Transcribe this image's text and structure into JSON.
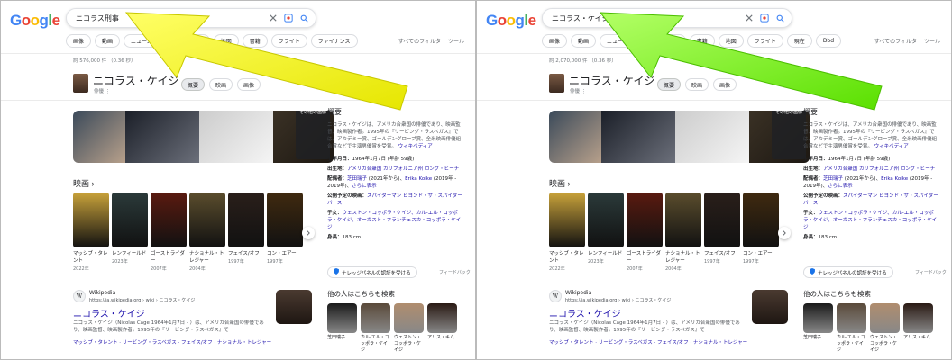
{
  "colors": {
    "arrow_left": "#ffff00",
    "arrow_right": "#7dff00",
    "link": "#1a0dab",
    "logo": [
      "#4285f4",
      "#ea4335",
      "#fbbc05",
      "#4285f4",
      "#34a853",
      "#ea4335"
    ]
  },
  "left": {
    "logo": "Google",
    "query": "ニコラス刑事",
    "chips": [
      "画像",
      "動画",
      "ニュース",
      "ショッピング",
      "地図",
      "書籍",
      "フライト",
      "ファイナンス"
    ],
    "filters": "すべてのフィルタ",
    "tools": "ツール",
    "stats": "約 576,000 件 （0.36 秒）",
    "entity_tabs": [
      "概要",
      "映画",
      "画像"
    ],
    "result_stats_count": "576,000"
  },
  "right": {
    "logo": "Google",
    "query": "ニコラス・ケイジ",
    "chips": [
      "画像",
      "動画",
      "ニュース",
      "ショッピング",
      "書籍",
      "地図",
      "フライト",
      "現在",
      "Dbd"
    ],
    "filters": "すべてのフィルタ",
    "tools": "ツール",
    "stats": "約 2,070,000 件 （0.36 秒）",
    "entity_tabs": [
      "概要",
      "映画",
      "画像"
    ]
  },
  "entity": {
    "name": "ニコラス・ケイジ",
    "subtitle": "俳優"
  },
  "strip": {
    "more_label": "その他の画像"
  },
  "movies_section": {
    "title": "映画"
  },
  "movies": [
    {
      "title": "マッシブ・タレント",
      "year": "2022年"
    },
    {
      "title": "レンフィールド",
      "year": "2023年"
    },
    {
      "title": "ゴーストライダー",
      "year": "2007年"
    },
    {
      "title": "ナショナル・トレジャー",
      "year": "2004年"
    },
    {
      "title": "フェイス/オフ",
      "year": "1997年"
    },
    {
      "title": "コン・エアー",
      "year": "1997年"
    }
  ],
  "knowledge": {
    "title": "概要",
    "desc": "ニコラス・ケイジは、アメリカ合衆国の俳優であり、映画監督、映画製作者。1995年の『リービング・ラスベガス』では、アカデミー賞、ゴールデングローブ賞、全米映画俳優組合賞などで主演男優賞を受賞。",
    "wiki_link": "ウィキペディア",
    "born_label": "生年月日：",
    "born_value": "1964年1月7日 (年齢 59歳)",
    "birthplace_label": "出生地：",
    "birthplace_value": "アメリカ合衆国 カリフォルニア州 ロング・ビーチ",
    "spouse_label": "配偶者：",
    "spouse_1": "芝田瑞子",
    "spouse_1_years": " (2021年から)、",
    "spouse_2": "Erika Koike",
    "spouse_2_years": " (2019年 - 2019年)、",
    "spouse_more": "さらに表示",
    "upcoming_label": "公開予定の映画：",
    "upcoming_value": "スパイダーマン ビヨンド・ザ・スパイダーバース",
    "children_label": "子女：",
    "children_value": "ウェストン・コッポラ・ケイジ、カル-エル・コッポラ・ケイジ、オーガスト・フランチェスカ・コッポラ・ケイジ",
    "height_label": "身長：",
    "height_value": "183 cm"
  },
  "verify_label": "ナレッジパネルの認証を受ける",
  "feedback": "フィードバック",
  "result": {
    "site": "Wikipedia",
    "url": "https://ja.wikipedia.org › wiki › ニコラス・ケイジ",
    "title": "ニコラス・ケイジ",
    "snippet": "ニコラス・ケイジ（Nicolas Cage 1964年1月7日 - ）は、アメリカ合衆国の俳優であり、映画監督、映画製作者。1995年の『リービング・ラスベガス』で",
    "links": "マッシブ・タレント · リービング・ラスベガス · フェイス/オフ · ナショナル・トレジャー"
  },
  "people_also": {
    "title": "他の人はこちらも検索"
  },
  "people": [
    {
      "name": "芝田瑞子"
    },
    {
      "name": "カル-エル・コッポラ・ケイジ"
    },
    {
      "name": "ウェストン・コッポラ・ケイジ"
    },
    {
      "name": "アリス・キム"
    }
  ]
}
